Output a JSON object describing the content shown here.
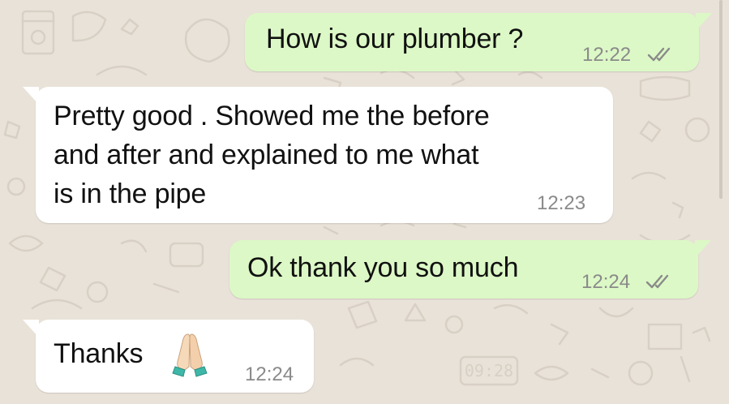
{
  "chat": {
    "messages": [
      {
        "direction": "outgoing",
        "text": "How is our plumber ?",
        "time": "12:22",
        "status": "read"
      },
      {
        "direction": "incoming",
        "lines": [
          "Pretty good . Showed me the before",
          "and after and explained to me what",
          "is in the pipe"
        ],
        "time": "12:23"
      },
      {
        "direction": "outgoing",
        "text": "Ok thank you so much",
        "time": "12:24",
        "status": "read"
      },
      {
        "direction": "incoming",
        "text": "Thanks",
        "emoji": "folded-hands-emoji",
        "time": "12:24"
      }
    ]
  },
  "wallpaper": {
    "clock_text": "09:28"
  },
  "colors": {
    "background": "#e9e2d8",
    "outgoing_bubble": "#dcf8c6",
    "incoming_bubble": "#ffffff",
    "timestamp": "#8a8a8a",
    "ticks": "#8a8a8a"
  }
}
